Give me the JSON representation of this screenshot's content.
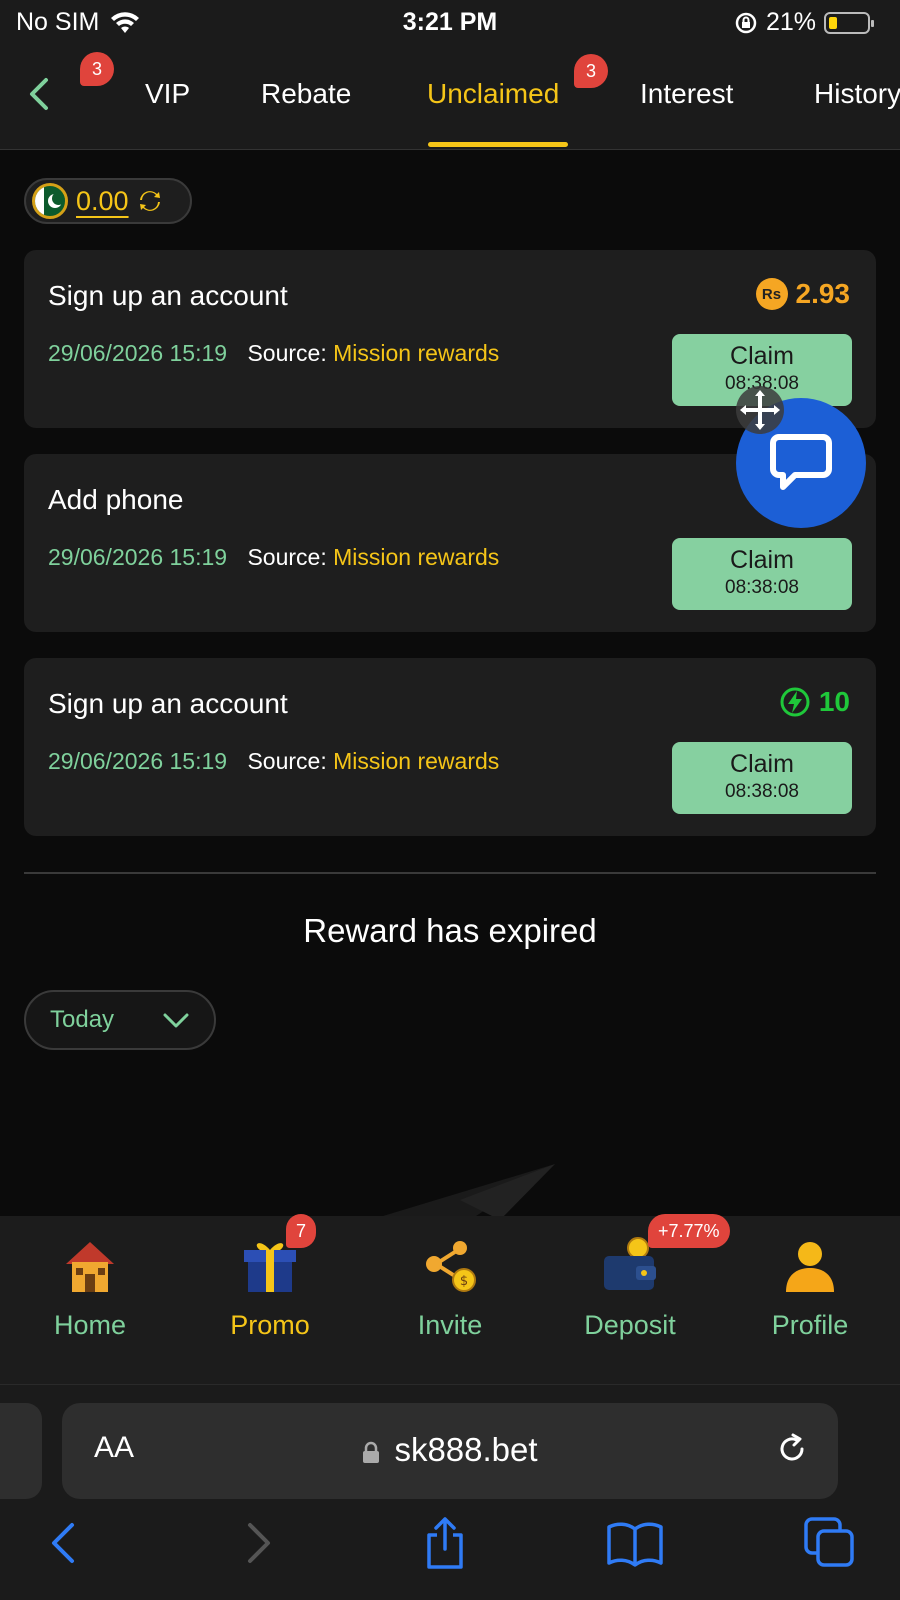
{
  "status_bar": {
    "carrier": "No SIM",
    "time": "3:21 PM",
    "battery_percent": "21%"
  },
  "tabs": {
    "items": [
      {
        "label": "VIP",
        "badge": "3"
      },
      {
        "label": "Rebate"
      },
      {
        "label": "Unclaimed",
        "badge": "3"
      },
      {
        "label": "Interest"
      },
      {
        "label": "History"
      }
    ],
    "active": "Unclaimed"
  },
  "balance": {
    "value": "0.00",
    "currency_flag": "pakistan-flag-icon"
  },
  "rewards": [
    {
      "title": "Sign up an account",
      "date": "29/06/2026 15:19",
      "source_label": "Source:",
      "source": "Mission rewards",
      "amount": "2.93",
      "amount_icon": "Rs",
      "claim_label": "Claim",
      "timer": "08:38:08"
    },
    {
      "title": "Add phone",
      "date": "29/06/2026 15:19",
      "source_label": "Source:",
      "source": "Mission rewards",
      "claim_label": "Claim",
      "timer": "08:38:08"
    },
    {
      "title": "Sign up an account",
      "date": "29/06/2026 15:19",
      "source_label": "Source:",
      "source": "Mission rewards",
      "amount": "10",
      "amount_icon": "energy-icon",
      "claim_label": "Claim",
      "timer": "08:38:08"
    }
  ],
  "expired": {
    "title": "Reward has expired",
    "filter_value": "Today"
  },
  "bottom_nav": {
    "items": [
      {
        "label": "Home",
        "icon": "house-icon"
      },
      {
        "label": "Promo",
        "icon": "gift-icon",
        "badge": "7"
      },
      {
        "label": "Invite",
        "icon": "share-coin-icon"
      },
      {
        "label": "Deposit",
        "icon": "wallet-icon",
        "badge": "+7.77%"
      },
      {
        "label": "Profile",
        "icon": "person-icon"
      }
    ],
    "active": "Promo"
  },
  "browser": {
    "aa_label": "AA",
    "url": "sk888.bet"
  },
  "colors": {
    "accent_yellow": "#f5c518",
    "accent_green": "#7fd19c",
    "claim_button": "#86d0a0",
    "badge_red": "#e0443c",
    "chat_blue": "#1c5fd6"
  }
}
